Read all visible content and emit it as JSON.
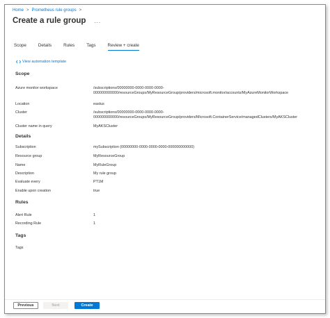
{
  "breadcrumb": {
    "home": "Home",
    "parent": "Prometheus rule groups",
    "sep": ">"
  },
  "page": {
    "title": "Create a rule group",
    "more": "..."
  },
  "tabs": [
    {
      "label": "Scope"
    },
    {
      "label": "Details"
    },
    {
      "label": "Rules"
    },
    {
      "label": "Tags"
    },
    {
      "label": "Review + create",
      "active": true
    }
  ],
  "automation_link": "View automation template",
  "sections": {
    "scope": {
      "heading": "Scope",
      "rows": [
        {
          "label": "Azure monitor workspace",
          "value": "/subscriptions/00000000-0000-0000-0000-000000000000/resourceGroups/MyResourceGroup/providers/microsoft.monitor/accounts/MyAzureMonitorWorkspace"
        },
        {
          "label": "Location",
          "value": "eastus"
        },
        {
          "label": "Cluster",
          "value": "/subscriptions/00000000-0000-0000-0000-000000000000/resourceGroups/MyResourceGroup/providers/Microsoft.ContainerService/managedClusters/MyAKSCluster"
        },
        {
          "label": "Cluster name in query",
          "value": "MyAKSCluster"
        }
      ]
    },
    "details": {
      "heading": "Details",
      "rows": [
        {
          "label": "Subscription",
          "value": "mySubscription (00000000-0000-0000-0000-000000000000)"
        },
        {
          "label": "Resource group",
          "value": "MyResourceGroup"
        },
        {
          "label": "Name",
          "value": "MyRuleGroup"
        },
        {
          "label": "Description",
          "value": "My rule group"
        },
        {
          "label": "Evaluate every",
          "value": "PT1M"
        },
        {
          "label": "Enable upon creation",
          "value": "true"
        }
      ]
    },
    "rules": {
      "heading": "Rules",
      "rows": [
        {
          "label": "Alert Rule",
          "value": "1"
        },
        {
          "label": "Recording Rule",
          "value": "1"
        }
      ]
    },
    "tags": {
      "heading": "Tags",
      "rows": [
        {
          "label": "Tags",
          "value": ""
        }
      ]
    }
  },
  "footer": {
    "previous": "Previous",
    "next": "Next",
    "create": "Create"
  },
  "colors": {
    "accent": "#0078d4",
    "text": "#323130",
    "disabled": "#a19f9d"
  }
}
